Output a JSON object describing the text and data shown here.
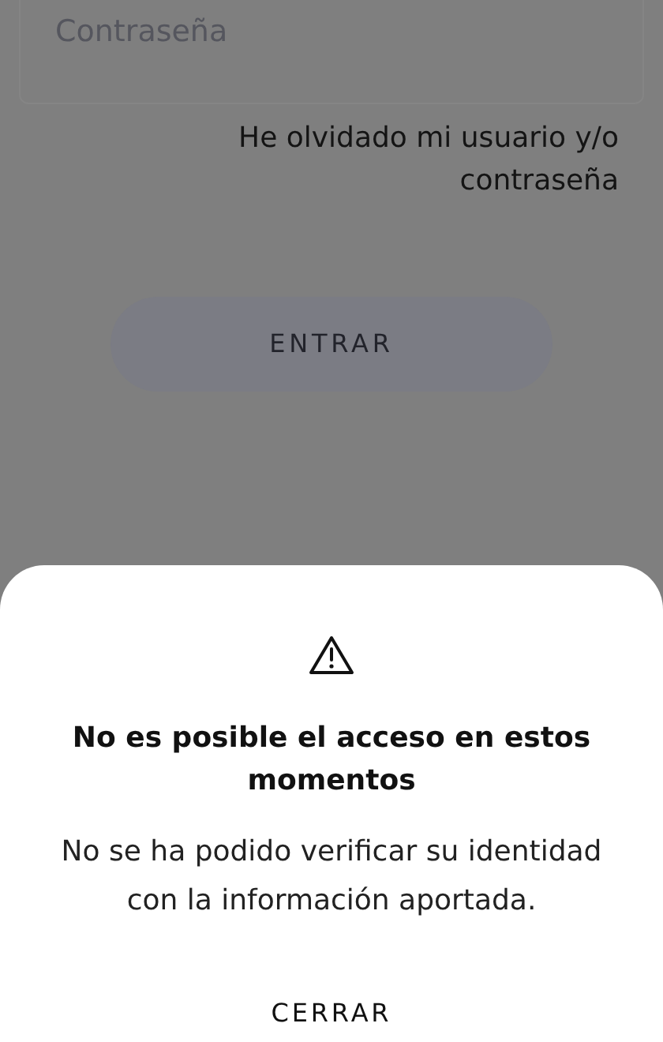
{
  "login": {
    "password_field": {
      "placeholder": "Contraseña"
    },
    "forgot_link": "He olvidado mi usuario y/o contraseña",
    "submit_button": "ENTRAR"
  },
  "dialog": {
    "title": "No es posible el acceso en estos momentos",
    "message": "No se ha podido verificar su identidad con la información aportada.",
    "close_button": "CERRAR"
  }
}
